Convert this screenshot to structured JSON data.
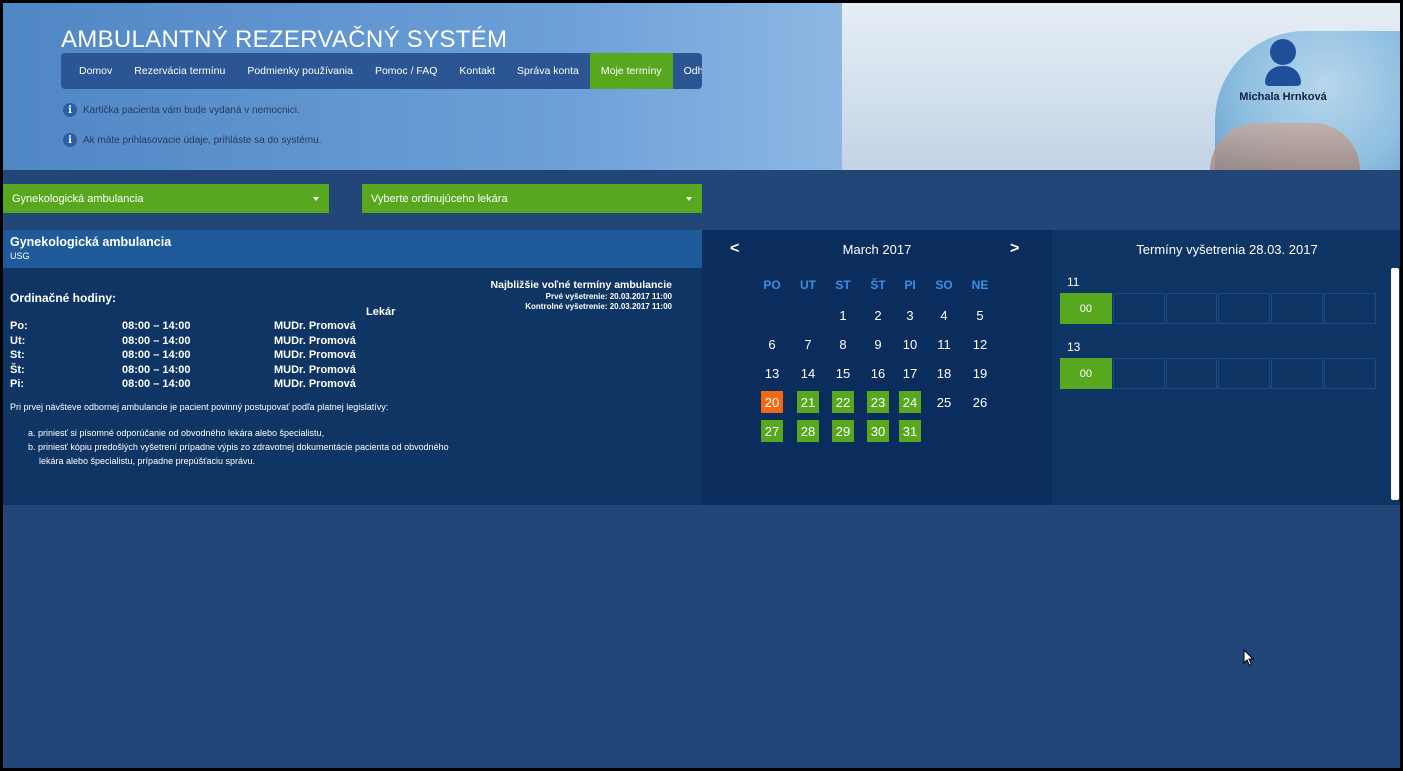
{
  "header": {
    "title": "AMBULANTNÝ REZERVAČNÝ SYSTÉM",
    "info_lines": [
      "Kartička pacienta vám bude vydaná v nemocnici.",
      "Ak máte prihlasovacie údaje, prihláste sa do systému."
    ],
    "user": {
      "name": "Michala Hrnková",
      "icon": "user-avatar-icon"
    }
  },
  "nav": {
    "items": [
      "Domov",
      "Rezervácia termínu",
      "Podmienky používania",
      "Pomoc / FAQ",
      "Kontakt",
      "Správa konta",
      "Moje termíny",
      "Odhlásiť"
    ],
    "active": "Moje termíny"
  },
  "filters": {
    "ambulance": "Gynekologická ambulancia",
    "doctor": "Vyberte ordinujúceho lekára"
  },
  "info": {
    "title": "Gynekologická ambulancia",
    "subtitle": "USG",
    "hours_title": "Ordinačné hodiny:",
    "doctor_header": "Lekár",
    "hours": [
      {
        "day": "Po:",
        "time": "08:00 – 14:00",
        "doctor": "MUDr. Promová"
      },
      {
        "day": "Ut:",
        "time": "08:00 – 14:00",
        "doctor": "MUDr. Promová"
      },
      {
        "day": "St:",
        "time": "08:00 – 14:00",
        "doctor": "MUDr. Promová"
      },
      {
        "day": "Št:",
        "time": "08:00 – 14:00",
        "doctor": "MUDr. Promová"
      },
      {
        "day": "Pi:",
        "time": "08:00 – 14:00",
        "doctor": "MUDr. Promová"
      }
    ],
    "nearest": {
      "title": "Najbližšie voľné termíny ambulancie",
      "first": "Prvé vyšetrenie: 20.03.2017 11:00",
      "control": "Kontrolné vyšetrenie: 20.03.2017 11:00"
    },
    "legislation": "Pri prvej návšteve odbornej ambulancie je pacient povinný postupovať podľa platnej legislatívy:",
    "legislation_items": [
      "a. priniesť si písomné odporúčanie od obvodného lekára alebo špecialistu,",
      "b. priniesť kópiu predošlých vyšetrení prípadne výpis zo zdravotnej dokumentácie pacienta od obvodného",
      "lekára alebo špecialistu, prípadne prepúšťaciu správu."
    ]
  },
  "calendar": {
    "prev": "<",
    "next": ">",
    "month": "March 2017",
    "weekdays": [
      "PO",
      "UT",
      "ST",
      "ŠT",
      "PI",
      "SO",
      "NE"
    ],
    "weeks": [
      [
        null,
        null,
        "1",
        "2",
        "3",
        "4",
        "5"
      ],
      [
        "6",
        "7",
        "8",
        "9",
        "10",
        "11",
        "12"
      ],
      [
        "13",
        "14",
        "15",
        "16",
        "17",
        "18",
        "19"
      ],
      [
        "20",
        "21",
        "22",
        "23",
        "24",
        "25",
        "26"
      ],
      [
        "27",
        "28",
        "29",
        "30",
        "31",
        null,
        null
      ]
    ],
    "available_days": [
      "21",
      "22",
      "23",
      "24",
      "27",
      "28",
      "29",
      "30",
      "31"
    ],
    "selected_day": "20",
    "colors": {
      "available": "#58a81f",
      "selected": "#ef6a12"
    }
  },
  "slots": {
    "title": "Termíny vyšetrenia 28.03. 2017",
    "hours": [
      {
        "hour": "11",
        "slots": [
          "00",
          "",
          "",
          "",
          "",
          ""
        ]
      },
      {
        "hour": "13",
        "slots": [
          "00",
          "",
          "",
          "",
          "",
          ""
        ]
      }
    ]
  }
}
